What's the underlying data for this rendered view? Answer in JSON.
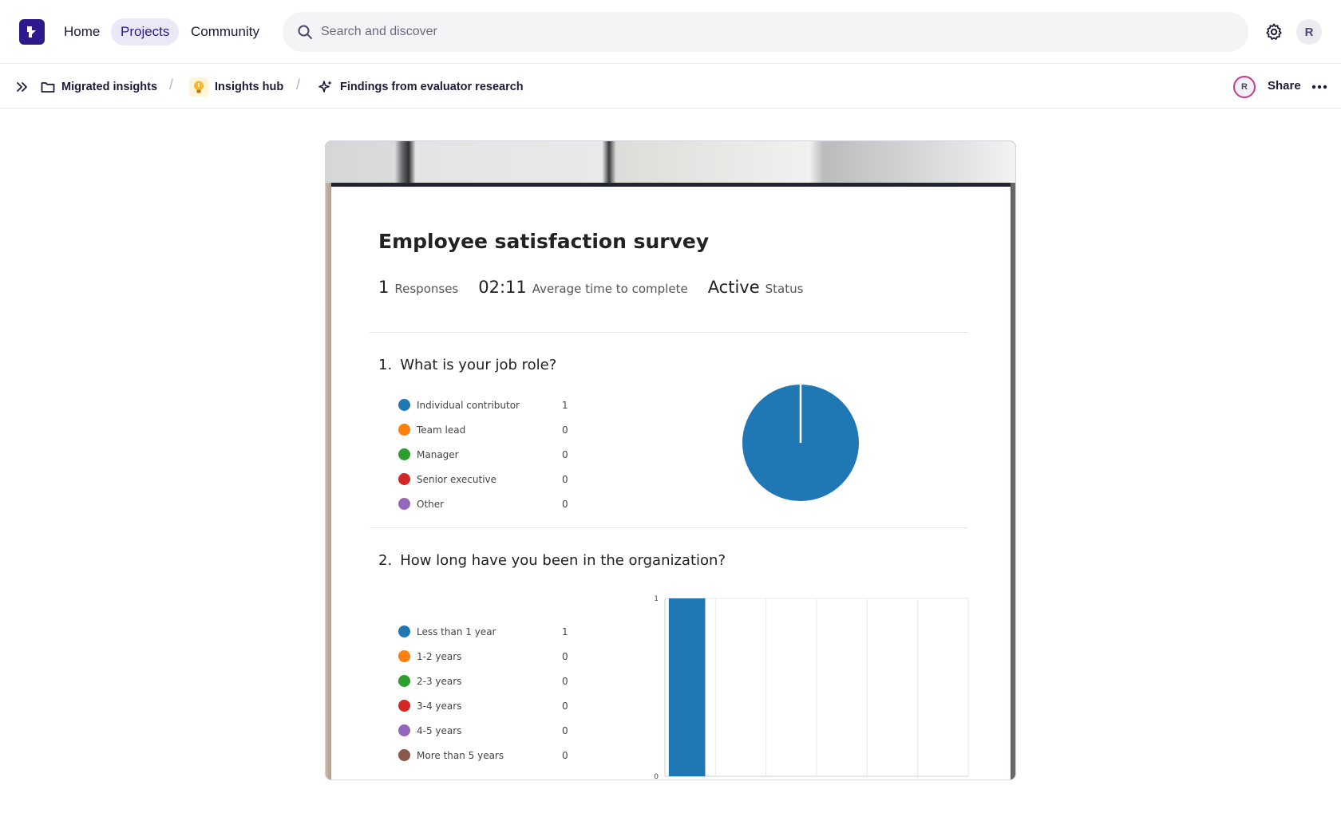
{
  "topnav": {
    "links": [
      "Home",
      "Projects",
      "Community"
    ],
    "active": "Projects",
    "search_placeholder": "Search and discover",
    "avatar_initial": "R"
  },
  "breadcrumb": {
    "items": [
      "Migrated insights",
      "Insights hub",
      "Findings from evaluator research"
    ],
    "avatar_initial": "R",
    "share_label": "Share"
  },
  "survey": {
    "title": "Employee satisfaction survey",
    "stats": [
      {
        "value": "1",
        "label": "Responses"
      },
      {
        "value": "02:11",
        "label": "Average time to complete"
      },
      {
        "value": "Active",
        "label": "Status"
      }
    ],
    "questions": [
      {
        "number": "1.",
        "title": "What is your job role?",
        "options": [
          {
            "label": "Individual contributor",
            "count": "1",
            "color": "#1f77b4"
          },
          {
            "label": "Team lead",
            "count": "0",
            "color": "#ff7f0e"
          },
          {
            "label": "Manager",
            "count": "0",
            "color": "#2ca02c"
          },
          {
            "label": "Senior executive",
            "count": "0",
            "color": "#d62728"
          },
          {
            "label": "Other",
            "count": "0",
            "color": "#9467bd"
          }
        ]
      },
      {
        "number": "2.",
        "title": "How long have you been in the organization?",
        "options": [
          {
            "label": "Less than 1 year",
            "count": "1",
            "color": "#1f77b4"
          },
          {
            "label": "1-2 years",
            "count": "0",
            "color": "#ff7f0e"
          },
          {
            "label": "2-3 years",
            "count": "0",
            "color": "#2ca02c"
          },
          {
            "label": "3-4 years",
            "count": "0",
            "color": "#d62728"
          },
          {
            "label": "4-5 years",
            "count": "0",
            "color": "#9467bd"
          },
          {
            "label": "More than 5 years",
            "count": "0",
            "color": "#8c564b"
          }
        ]
      }
    ]
  },
  "chart_data": [
    {
      "type": "pie",
      "categories": [
        "Individual contributor",
        "Team lead",
        "Manager",
        "Senior executive",
        "Other"
      ],
      "values": [
        1,
        0,
        0,
        0,
        0
      ],
      "colors": [
        "#1f77b4",
        "#ff7f0e",
        "#2ca02c",
        "#d62728",
        "#9467bd"
      ]
    },
    {
      "type": "bar",
      "categories": [
        "Less than 1 year",
        "1-2 years",
        "2-3 years",
        "3-4 years",
        "4-5 years",
        "More than 5 years"
      ],
      "values": [
        1,
        0,
        0,
        0,
        0,
        0
      ],
      "ylim": [
        0,
        1
      ],
      "yticks": [
        "0",
        "1"
      ],
      "color": "#1f77b4",
      "grid": true
    }
  ]
}
